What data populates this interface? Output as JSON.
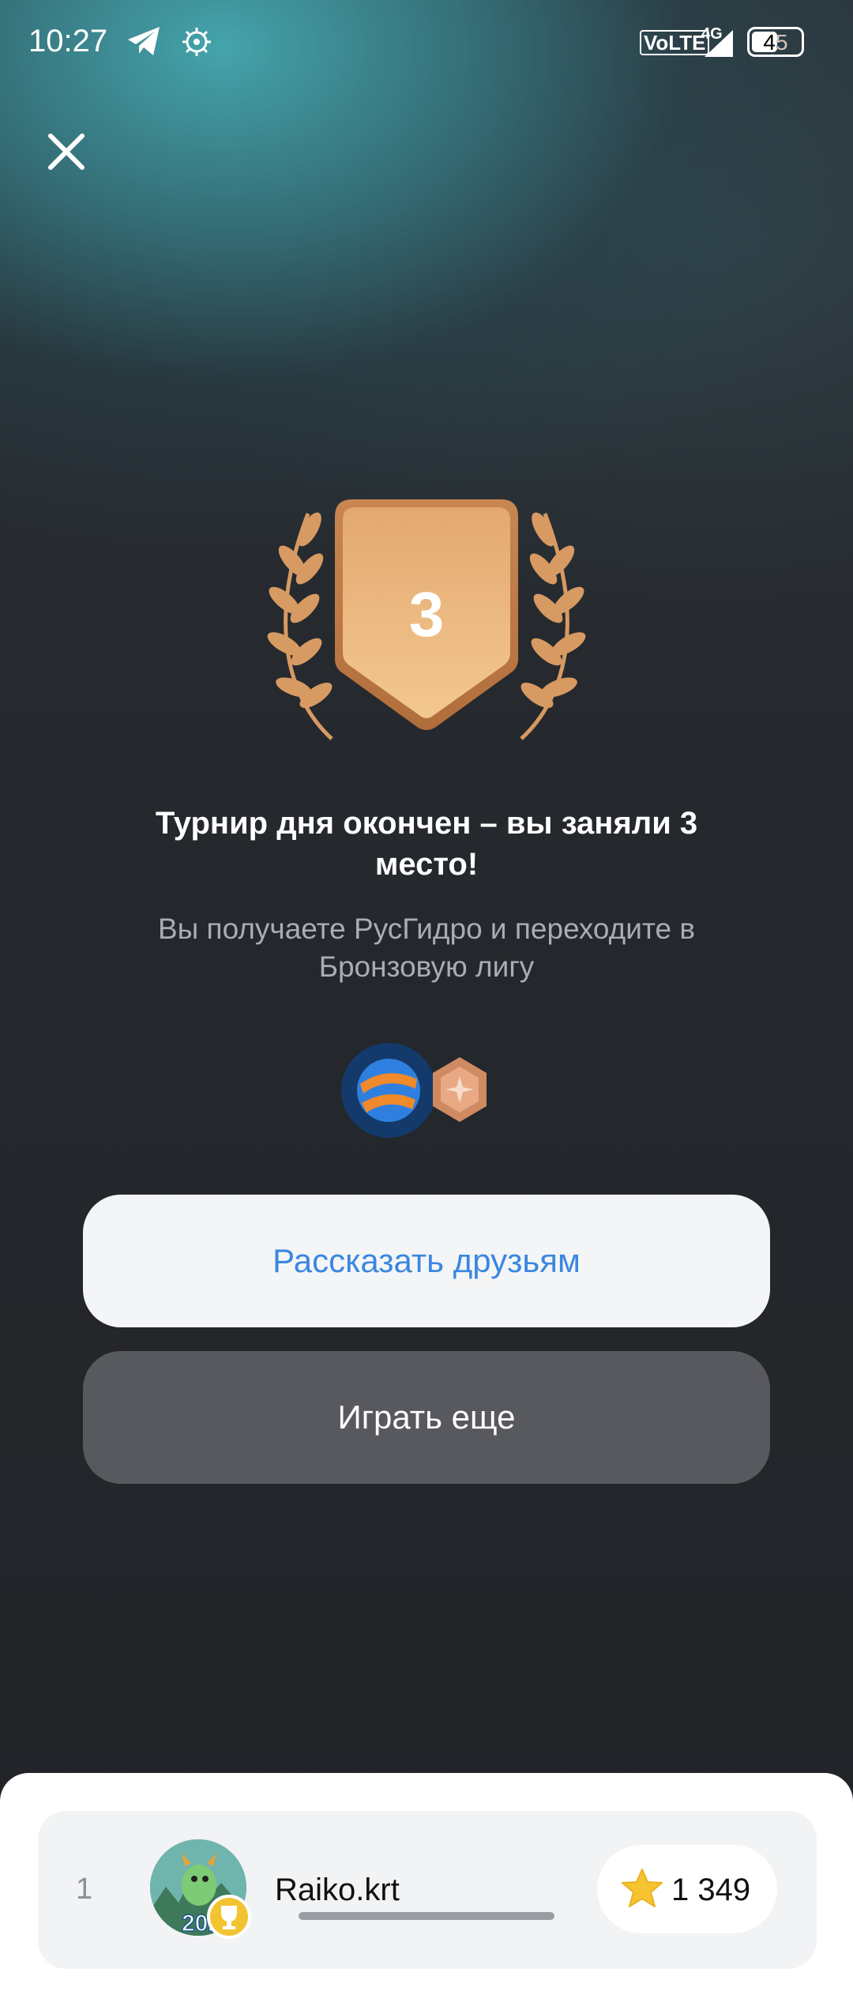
{
  "status_bar": {
    "time": "10:27",
    "network": "VoLTE",
    "signal": "4G",
    "battery": "45",
    "icons": [
      "telegram-icon",
      "settings-bug-icon",
      "signal-icon",
      "battery-icon"
    ]
  },
  "close_icon": "close-icon",
  "badge": {
    "place": "3"
  },
  "result": {
    "title": "Турнир дня окончен – вы заняли 3 место!",
    "subtitle": "Вы получаете РусГидро и переходите в Бронзовую лигу"
  },
  "rewards": [
    "rushydro-logo-icon",
    "bronze-league-icon"
  ],
  "buttons": {
    "share": "Рассказать друзьям",
    "play": "Играть еще"
  },
  "leaderboard": {
    "rows": [
      {
        "rank": "1",
        "name": "Raiko.krt",
        "score": "1 349",
        "avatar_text": "202"
      }
    ]
  },
  "colors": {
    "accent_blue": "#3a87e0",
    "bronze": "#d79a63",
    "background": "#23252a"
  }
}
